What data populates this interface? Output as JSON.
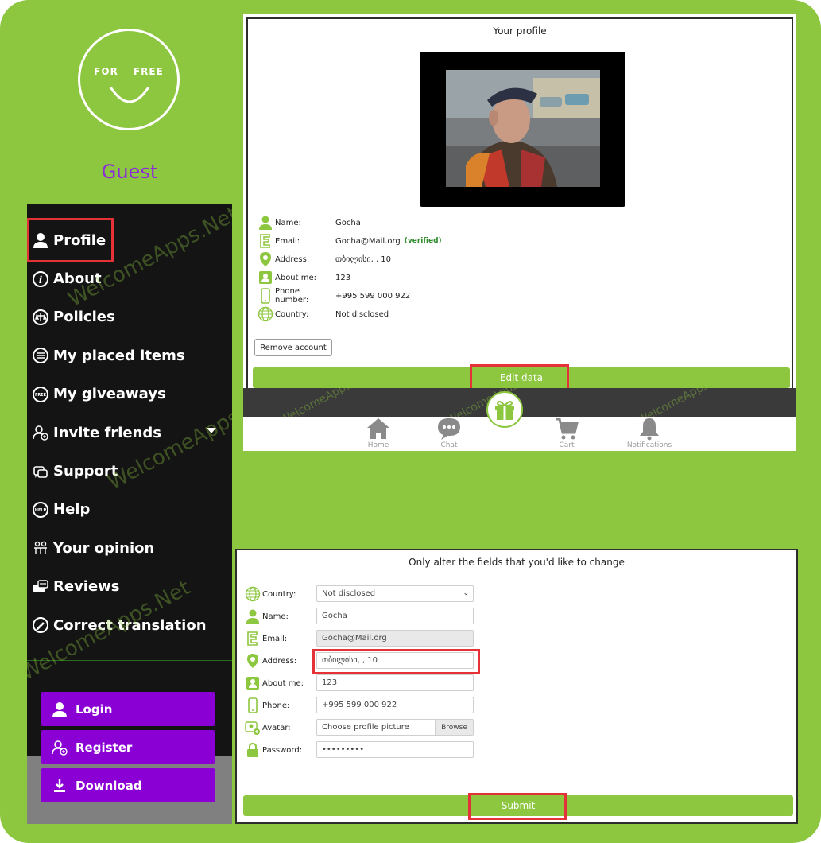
{
  "colors": {
    "brand_green": "#8dc63f",
    "sidebar_dark": "#141414",
    "purple": "#8a00d4",
    "guest_purple": "#8c2bd9",
    "highlight_red": "#e53238"
  },
  "sidebar": {
    "logo_text": "FOR FREE",
    "user_name": "Guest",
    "items": [
      {
        "label": "Profile",
        "icon": "person-icon"
      },
      {
        "label": "About",
        "icon": "info-icon"
      },
      {
        "label": "Policies",
        "icon": "scales-icon"
      },
      {
        "label": "My placed items",
        "icon": "list-icon"
      },
      {
        "label": "My giveaways",
        "icon": "giveaway-icon"
      },
      {
        "label": "Invite friends",
        "icon": "add-user-icon"
      },
      {
        "label": "Support",
        "icon": "support-icon"
      },
      {
        "label": "Help",
        "icon": "help-icon"
      },
      {
        "label": "Your opinion",
        "icon": "opinion-icon"
      },
      {
        "label": "Reviews",
        "icon": "reviews-icon"
      },
      {
        "label": "Correct translation",
        "icon": "edit-icon"
      }
    ],
    "auth": {
      "login": "Login",
      "register": "Register",
      "download": "Download"
    }
  },
  "watermark": "WelcomeApps.Net",
  "profile": {
    "title": "Your profile",
    "fields": [
      {
        "label": "Name:",
        "value": "Gocha",
        "icon": "person-icon"
      },
      {
        "label": "Email:",
        "value": "Gocha@Mail.org",
        "icon": "email-icon"
      },
      {
        "label": "Address:",
        "value": "თბილისი, , 10",
        "icon": "location-icon"
      },
      {
        "label": "About me:",
        "value": "123",
        "icon": "contact-card-icon"
      },
      {
        "label": "Phone number:",
        "value": "+995 599 000 922",
        "icon": "phone-icon"
      },
      {
        "label": "Country:",
        "value": "Not disclosed",
        "icon": "globe-icon"
      }
    ],
    "verified": "(verified)",
    "remove_account": "Remove account",
    "edit_data": "Edit data"
  },
  "tabbar": {
    "home": "Home",
    "chat": "Chat",
    "cart": "Cart",
    "notifications": "Notifications"
  },
  "edit_form": {
    "title": "Only alter the fields that you'd like to change",
    "country_label": "Country:",
    "country_value": "Not disclosed",
    "name_label": "Name:",
    "name_value": "Gocha",
    "email_label": "Email:",
    "email_value": "Gocha@Mail.org",
    "address_label": "Address:",
    "address_value": "თბილისი, , 10",
    "about_label": "About me:",
    "about_value": "123",
    "phone_label": "Phone:",
    "phone_value": "+995 599 000 922",
    "avatar_label": "Avatar:",
    "avatar_placeholder": "Choose profile picture",
    "browse": "Browse",
    "password_label": "Password:",
    "password_value": "•••••••••",
    "submit": "Submit"
  }
}
